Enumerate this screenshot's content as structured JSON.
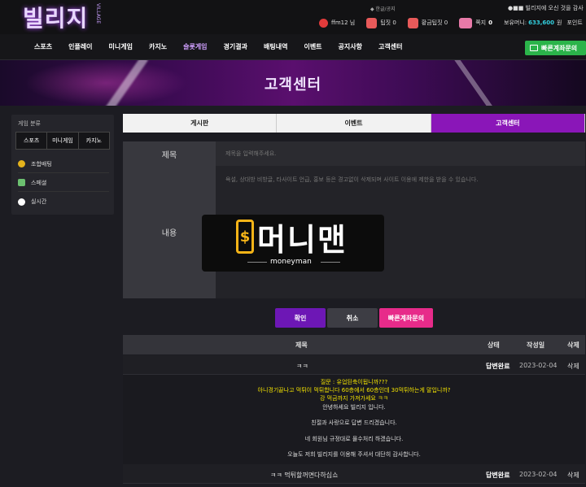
{
  "header": {
    "logo": "빌리지",
    "logo_sub": "VILLAGE",
    "ticker": "●■■ 빌리지에 오신 것을 감사",
    "lang": "◆ 한글/공지"
  },
  "stats": {
    "user": "ffm12 님",
    "ticket": "팁짓 0",
    "gold_ticket": "황금팁짓 0",
    "points_label": "쪽지",
    "points": "0",
    "money_label": "보유머니:",
    "money": "633,600",
    "money_unit": "원",
    "points_note": "포인트"
  },
  "nav": {
    "items": [
      "스포츠",
      "인플레이",
      "미니게임",
      "카지노",
      "슬롯게임",
      "경기결과",
      "배팅내역",
      "이벤트",
      "공지사항",
      "고객센터"
    ],
    "quick_account": "빠른계좌문의"
  },
  "banner": {
    "title": "고객센터"
  },
  "sidebar": {
    "title": "게임 분류",
    "tabs": [
      "스포츠",
      "미니게임",
      "카지노"
    ],
    "items": [
      "조합배팅",
      "스페셜",
      "실시간"
    ]
  },
  "tabs": [
    "게시판",
    "이벤트",
    "고객센터"
  ],
  "form": {
    "title_label": "제목",
    "title_placeholder": "제목을 입력해주세요.",
    "body_label": "내용",
    "body_placeholder": "욕설, 상대방 비방글, 타사이트 언급, 홍보 등은 경고없이 삭제되며 사이트 이용에 제한을 받을 수 있습니다."
  },
  "watermark": {
    "text": "머니맨",
    "sub": "moneyman"
  },
  "buttons": {
    "ok": "확인",
    "cancel": "취소",
    "account": "빠른계좌문의"
  },
  "table": {
    "headers": [
      "제목",
      "상태",
      "작성일",
      "삭제"
    ],
    "rows": [
      {
        "title": "ㅋㅋ",
        "status": "답변완료",
        "date": "2023-02-04",
        "delete": "삭제"
      },
      {
        "title": "ㅋㅋ 먹튀할꺼면다하십쇼",
        "status": "답변완료",
        "date": "2023-02-04",
        "delete": "삭제"
      }
    ],
    "question": [
      "질문 : 유업된축이됩니까???",
      "아니경기끝나고 먹튀이 먹튀합니다 60층에서 60층인데 30먹튀하는게 말입니까?",
      "강 먹금까지 가져가세요 ㅋㅋ"
    ],
    "answer": [
      "안녕하세요 빌리지 입니다.",
      "친절과 사랑으로 답변 드리겠습니다.",
      "네 회원님 규정대로 몰수처리 하겠습니다.",
      "오늘도 저희 빌리지를 이용해 주셔서 대단히 감사합니다."
    ]
  }
}
